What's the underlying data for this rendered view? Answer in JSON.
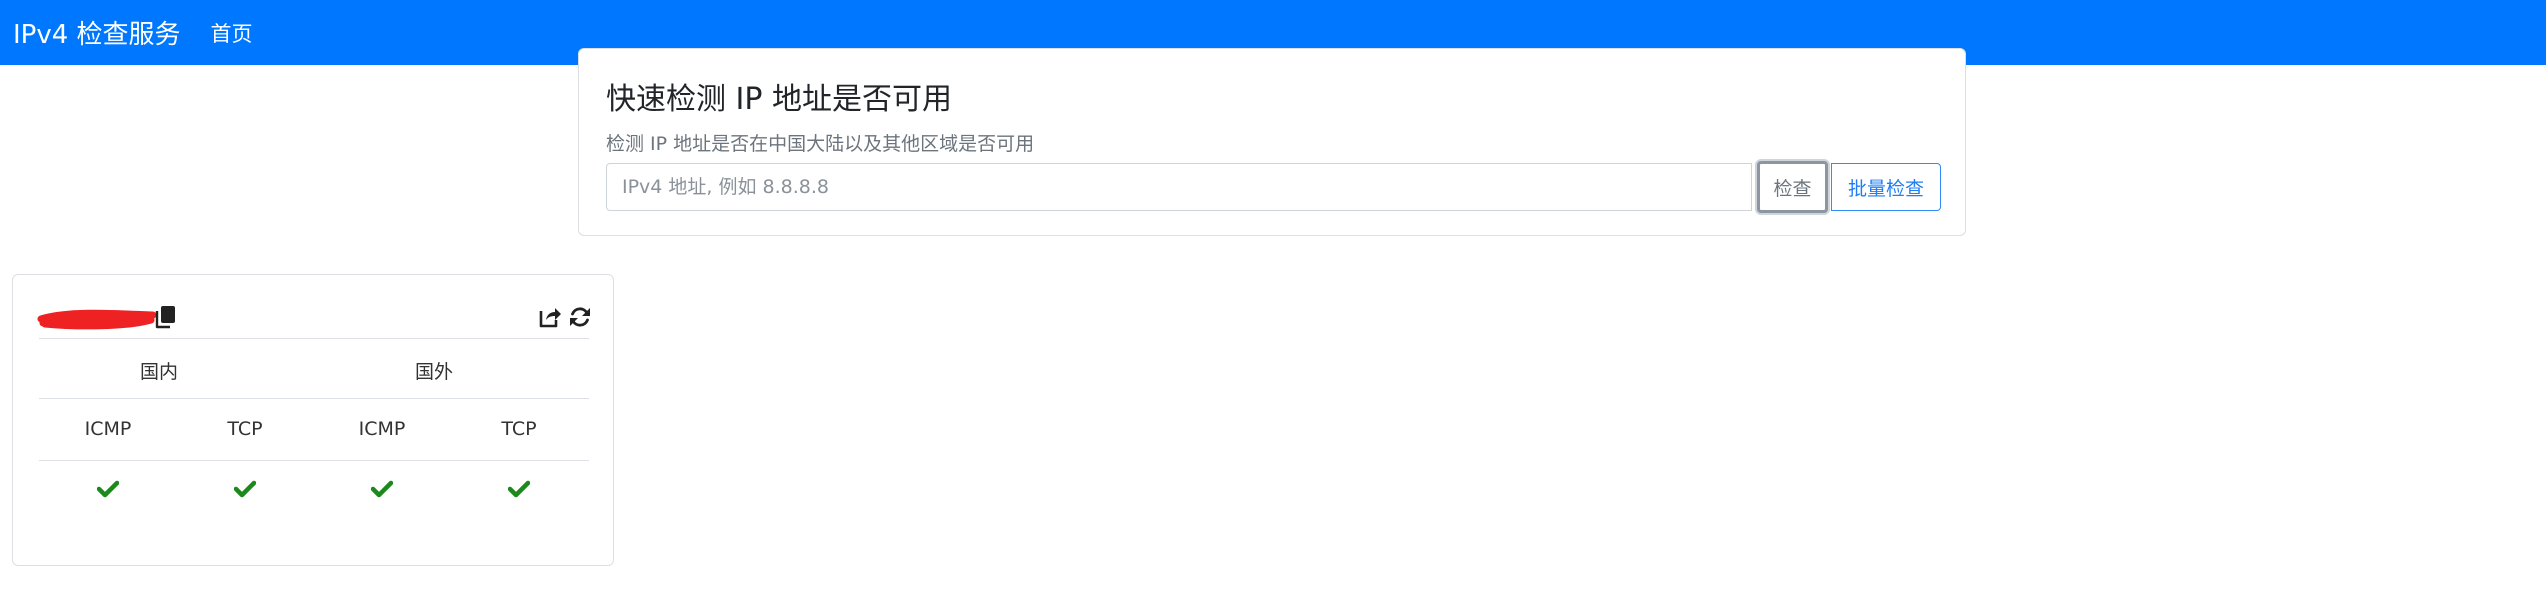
{
  "navbar": {
    "brand": "IPv4 检查服务",
    "home": "首页"
  },
  "check_card": {
    "title": "快速检测 IP 地址是否可用",
    "subtitle": "检测 IP 地址是否在中国大陆以及其他区域是否可用",
    "input_value": "",
    "input_placeholder": "IPv4 地址, 例如 8.8.8.8",
    "check_button": "检查",
    "batch_button": "批量检查"
  },
  "result_card": {
    "groups": [
      "国内",
      "国外"
    ],
    "columns": [
      "ICMP",
      "TCP",
      "ICMP",
      "TCP"
    ],
    "status": [
      "ok",
      "ok",
      "ok",
      "ok"
    ],
    "colors": {
      "ok": "#1b8a1b",
      "redaction": "#ee2222"
    }
  }
}
